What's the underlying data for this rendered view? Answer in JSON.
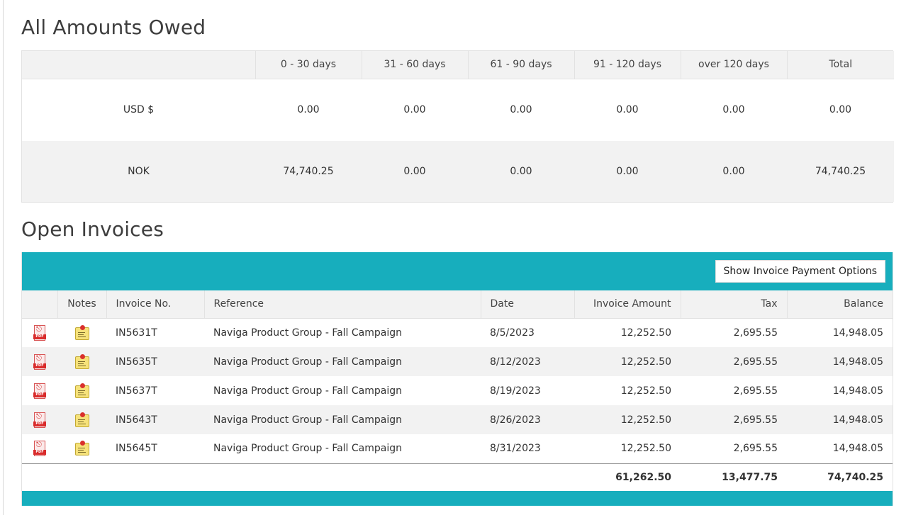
{
  "owed": {
    "title": "All Amounts Owed",
    "columns": [
      "",
      "0 - 30 days",
      "31 - 60 days",
      "61 - 90 days",
      "91 - 120 days",
      "over 120 days",
      "Total"
    ],
    "rows": [
      {
        "currency": "USD $",
        "values": [
          "0.00",
          "0.00",
          "0.00",
          "0.00",
          "0.00",
          "0.00"
        ]
      },
      {
        "currency": "NOK",
        "values": [
          "74,740.25",
          "0.00",
          "0.00",
          "0.00",
          "0.00",
          "74,740.25"
        ]
      }
    ]
  },
  "invoices": {
    "title": "Open Invoices",
    "payment_button": "Show Invoice Payment Options",
    "columns": {
      "pdf": "",
      "notes": "Notes",
      "invoice_no": "Invoice No.",
      "reference": "Reference",
      "date": "Date",
      "amount": "Invoice Amount",
      "tax": "Tax",
      "balance": "Balance"
    },
    "icons": {
      "pdf": "pdf-file-icon",
      "notes": "sticky-note-icon"
    },
    "rows": [
      {
        "invoice_no": "IN5631T",
        "reference": "Naviga Product Group - Fall Campaign",
        "date": "8/5/2023",
        "amount": "12,252.50",
        "tax": "2,695.55",
        "balance": "14,948.05"
      },
      {
        "invoice_no": "IN5635T",
        "reference": "Naviga Product Group - Fall Campaign",
        "date": "8/12/2023",
        "amount": "12,252.50",
        "tax": "2,695.55",
        "balance": "14,948.05"
      },
      {
        "invoice_no": "IN5637T",
        "reference": "Naviga Product Group - Fall Campaign",
        "date": "8/19/2023",
        "amount": "12,252.50",
        "tax": "2,695.55",
        "balance": "14,948.05"
      },
      {
        "invoice_no": "IN5643T",
        "reference": "Naviga Product Group - Fall Campaign",
        "date": "8/26/2023",
        "amount": "12,252.50",
        "tax": "2,695.55",
        "balance": "14,948.05"
      },
      {
        "invoice_no": "IN5645T",
        "reference": "Naviga Product Group - Fall Campaign",
        "date": "8/31/2023",
        "amount": "12,252.50",
        "tax": "2,695.55",
        "balance": "14,948.05"
      }
    ],
    "totals": {
      "amount": "61,262.50",
      "tax": "13,477.75",
      "balance": "74,740.25"
    }
  },
  "colors": {
    "accent": "#17aebd",
    "header_bg": "#f2f2f2",
    "pdf_red": "#d92b2b",
    "note_yellow": "#f6e27a"
  }
}
